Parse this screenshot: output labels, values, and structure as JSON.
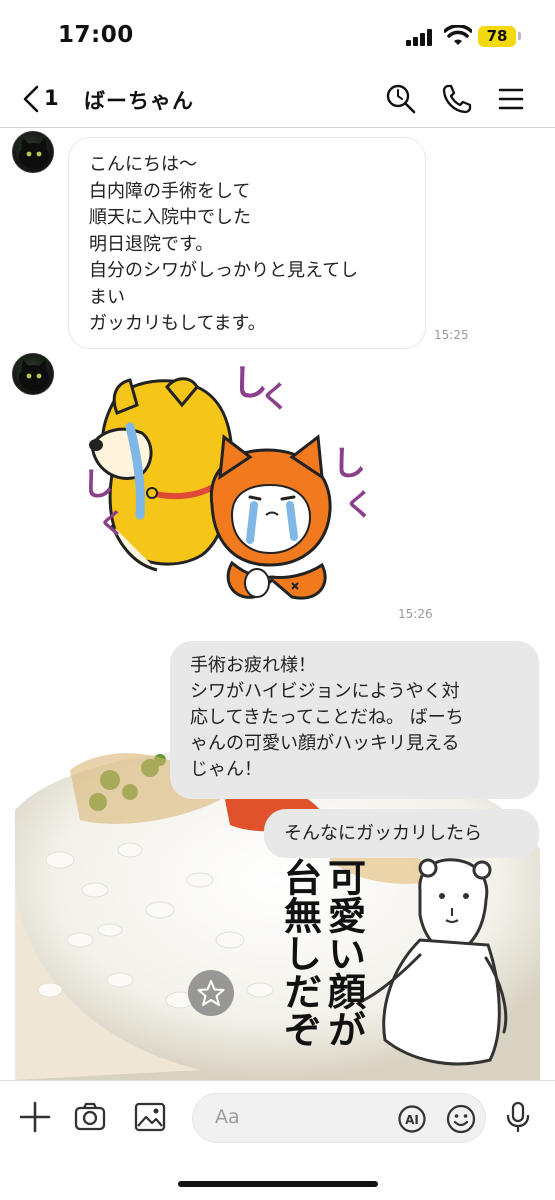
{
  "status_bar": {
    "time": "17:00",
    "battery": "78"
  },
  "header": {
    "back_count": "1",
    "title": "ばーちゃん"
  },
  "messages": [
    {
      "side": "in",
      "lines": [
        "こんにちは〜",
        "白内障の手術をして",
        "順天に入院中でした",
        "明日退院です。",
        "自分のシワがしっかりと見えてし",
        "まい",
        "ガッカリもしてます。"
      ],
      "time": "15:25"
    },
    {
      "side": "in",
      "type": "sticker",
      "sticker_text": [
        "し",
        "く",
        "し",
        "く",
        "し",
        "く"
      ],
      "time": "15:26"
    },
    {
      "side": "out",
      "lines": [
        "手術お疲れ様！",
        "シワがハイビジョンにようやく対",
        "応してきたってことだね。 ばーち",
        "ゃんの可愛い顔がハッキリ見える",
        "じゃん！"
      ]
    },
    {
      "side": "out",
      "lines": [
        "そんなにガッカリしたら"
      ]
    },
    {
      "side": "out",
      "type": "sticker",
      "sticker_text": [
        "可愛い顔が",
        "台無しだぞ"
      ]
    }
  ],
  "input": {
    "placeholder": "Aa",
    "ai_label": "AI"
  },
  "icons": {
    "back": "chevron-left-icon",
    "search": "search-icon",
    "call": "phone-icon",
    "menu": "hamburger-menu-icon",
    "plus": "plus-icon",
    "camera": "camera-icon",
    "image": "image-icon",
    "ai": "ai-icon",
    "emoji": "emoji-icon",
    "mic": "mic-icon",
    "star": "star-icon"
  },
  "colors": {
    "incoming_bubble": "#ffffff",
    "outgoing_bubble": "#e8e8e8",
    "battery": "#f5d90f",
    "sticker_purple": "#8c3f8a",
    "sticker_orange": "#f17a1e",
    "sticker_yellow": "#f5c518"
  }
}
